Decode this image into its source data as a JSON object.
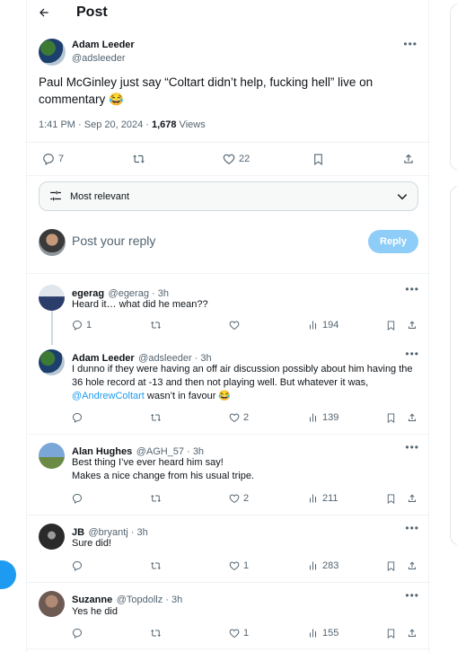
{
  "header": {
    "back_icon": "arrow-left-icon",
    "title": "Post"
  },
  "post": {
    "author_name": "Adam Leeder",
    "author_handle": "@adsleeder",
    "text": "Paul McGinley just say “Coltart didn’t help, fucking hell” live on commentary 😂",
    "time": "1:41 PM · Sep 20, 2024 · ",
    "views_count": "1,678",
    "views_label": " Views",
    "actions": {
      "replies": "7",
      "reposts": "",
      "likes": "22"
    }
  },
  "sort": {
    "label": "Most relevant"
  },
  "composer": {
    "placeholder": "Post your reply",
    "button": "Reply"
  },
  "replies": [
    {
      "name": "egerag",
      "handle": "@egerag · 3h",
      "text": "Heard it… what did he mean??",
      "replies": "1",
      "likes": "",
      "views": "194"
    },
    {
      "name": "Adam Leeder",
      "handle": "@adsleeder · 3h",
      "text_before": "I dunno if they were having an off air discussion possibly about him having the 36 hole record at -13 and then not playing well. But whatever it was, ",
      "mention": "@AndrewColtart",
      "text_after": " wasn’t in favour 😂",
      "replies": "",
      "likes": "2",
      "views": "139"
    },
    {
      "name": "Alan Hughes",
      "handle": "@AGH_57 · 3h",
      "text_line1": "Best thing I’ve ever heard him say!",
      "text_line2": "Makes a nice change from his usual tripe.",
      "replies": "",
      "likes": "2",
      "views": "211"
    },
    {
      "name": "JB",
      "handle": "@bryantj · 3h",
      "text": "Sure did!",
      "replies": "",
      "likes": "1",
      "views": "283"
    },
    {
      "name": "Suzanne",
      "handle": "@Topdollz · 3h",
      "text": "Yes he did",
      "replies": "",
      "likes": "1",
      "views": "155"
    }
  ],
  "colors": {
    "accent": "#1d9bf0",
    "muted": "#536471",
    "reply_button_disabled": "#8ecdf8"
  }
}
